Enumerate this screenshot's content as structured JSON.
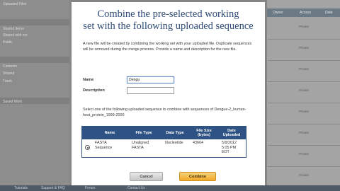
{
  "background": {
    "sidebar": {
      "items": [
        "Uploaded Files",
        "Shared Items",
        "Shared with me",
        "Public",
        "Contents",
        "Shared",
        "Trash",
        "Saved Work"
      ]
    },
    "table": {
      "headers": [
        "Owner",
        "Access",
        "Date"
      ],
      "access_values": [
        "Private",
        "Private",
        "Private",
        "Private",
        "Private",
        "Private",
        "Private",
        "Private"
      ]
    },
    "footer_links": [
      "Tutorials",
      "Support & FAQ",
      "Forum",
      "Contact Us"
    ]
  },
  "dialog": {
    "title": "Combine the pre-selected working\nset with the following uploaded sequence",
    "description": "A new file will be created by combining the working set with your uploaded file. Duplicate sequences will be removed during the merge process. Provide a name and description for the new file.",
    "name_label": "Name",
    "name_value": "Dengu",
    "description_label": "Description",
    "description_value": "",
    "select_instruction": "Select one of the following uploaded sequence to combine with sequences of Dengue-2_human-host_protein_1999-2000",
    "table": {
      "headers": [
        "Name",
        "File Type",
        "Data Type",
        "File Size\n(bytes)",
        "Date\nUploaded"
      ],
      "rows": [
        {
          "selected": true,
          "name": "FASTA\nSequence",
          "file_type": "Unaligned\nFASTA",
          "data_type": "Nucleotide",
          "file_size": "43664",
          "date_uploaded": "5/9/2012\n5:05 PM\nEDT"
        }
      ]
    },
    "cancel_label": "Cancel",
    "combine_label": "Combine"
  }
}
